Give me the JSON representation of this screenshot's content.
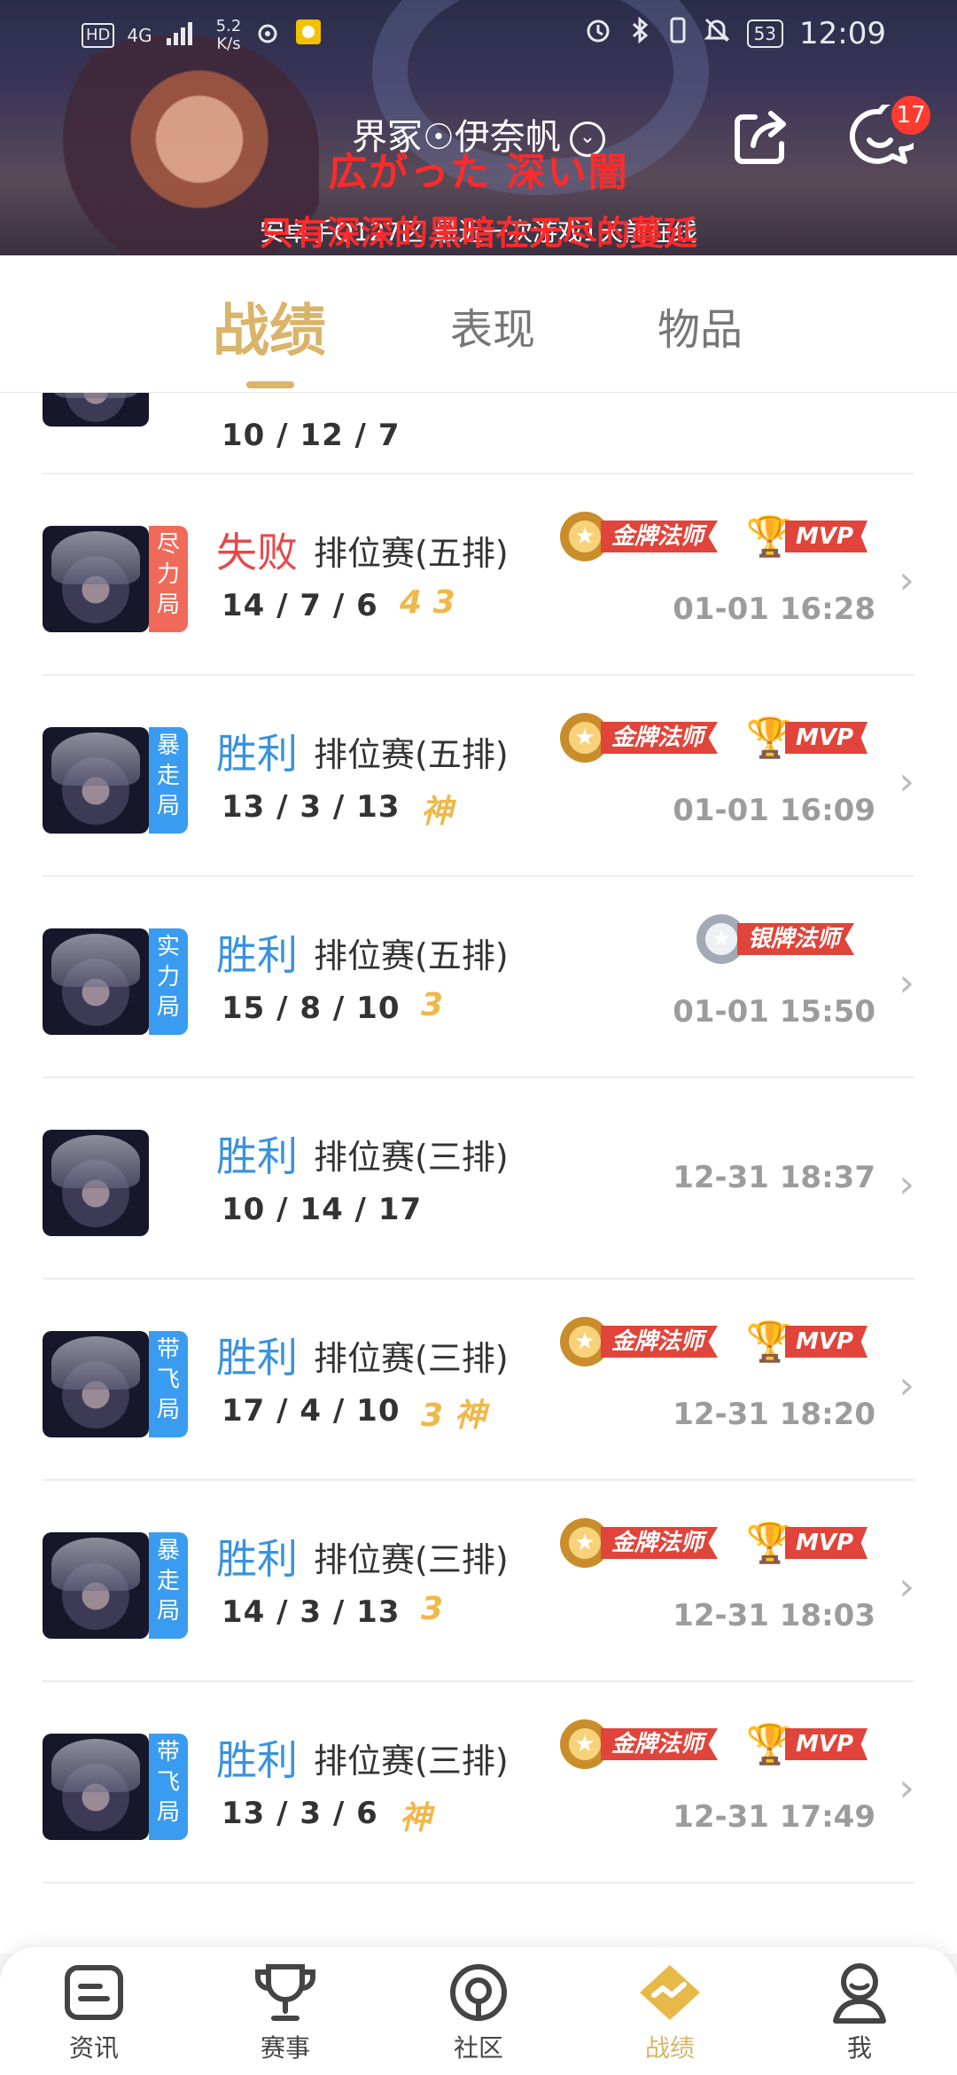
{
  "status_bar": {
    "hd": "HD",
    "network": "4G",
    "speed_value": "5.2",
    "speed_unit": "K/s",
    "battery": "53",
    "time": "12:09"
  },
  "header": {
    "profile_name": "界冢☉伊奈帆",
    "overlay_jp": "広がった 深い闇",
    "subtitle": "安卓手Q127区 最近一次游戏1天前在线",
    "overlay_cn": "只有深深的黑暗在无尽的蔓延",
    "message_badge": "17",
    "share_icon": "share-icon",
    "message_icon": "chat-icon"
  },
  "tabs": [
    {
      "label": "战绩",
      "active": true
    },
    {
      "label": "表现",
      "active": false
    },
    {
      "label": "物品",
      "active": false
    }
  ],
  "partial_row": {
    "kda": "10 / 12 / 7"
  },
  "matches": [
    {
      "tag": "尽力局",
      "tag_color": "red",
      "result": "失败",
      "win": false,
      "type": "排位赛(五排)",
      "kda": "14 / 7 / 6",
      "extras": "4  3",
      "badge": "金牌法师",
      "badge_kind": "gold",
      "mvp": "MVP",
      "time": "01-01 16:28"
    },
    {
      "tag": "暴走局",
      "tag_color": "blue",
      "result": "胜利",
      "win": true,
      "type": "排位赛(五排)",
      "kda": "13 / 3 / 13",
      "extras": "神",
      "badge": "金牌法师",
      "badge_kind": "gold",
      "mvp": "MVP",
      "time": "01-01 16:09"
    },
    {
      "tag": "实力局",
      "tag_color": "blue",
      "result": "胜利",
      "win": true,
      "type": "排位赛(五排)",
      "kda": "15 / 8 / 10",
      "extras": "3",
      "badge": "银牌法师",
      "badge_kind": "silver",
      "mvp": "",
      "time": "01-01 15:50"
    },
    {
      "tag": "",
      "tag_color": "",
      "result": "胜利",
      "win": true,
      "type": "排位赛(三排)",
      "kda": "10 / 14 / 17",
      "extras": "",
      "badge": "",
      "badge_kind": "",
      "mvp": "",
      "time": "12-31 18:37"
    },
    {
      "tag": "带飞局",
      "tag_color": "blue",
      "result": "胜利",
      "win": true,
      "type": "排位赛(三排)",
      "kda": "17 / 4 / 10",
      "extras": "3  神",
      "badge": "金牌法师",
      "badge_kind": "gold",
      "mvp": "MVP",
      "time": "12-31 18:20"
    },
    {
      "tag": "暴走局",
      "tag_color": "blue",
      "result": "胜利",
      "win": true,
      "type": "排位赛(三排)",
      "kda": "14 / 3 / 13",
      "extras": "3",
      "badge": "金牌法师",
      "badge_kind": "gold",
      "mvp": "MVP",
      "time": "12-31 18:03"
    },
    {
      "tag": "带飞局",
      "tag_color": "blue",
      "result": "胜利",
      "win": true,
      "type": "排位赛(三排)",
      "kda": "13 / 3 / 6",
      "extras": "神",
      "badge": "金牌法师",
      "badge_kind": "gold",
      "mvp": "MVP",
      "time": "12-31 17:49"
    }
  ],
  "bottom_nav": [
    {
      "label": "资讯",
      "icon": "news-icon",
      "active": false
    },
    {
      "label": "赛事",
      "icon": "trophy-icon",
      "active": false
    },
    {
      "label": "社区",
      "icon": "community-icon",
      "active": false
    },
    {
      "label": "战绩",
      "icon": "record-icon",
      "active": true
    },
    {
      "label": "我",
      "icon": "profile-icon",
      "active": false
    }
  ],
  "colors": {
    "accent_gold": "#d9b46a",
    "win_blue": "#3a92e0",
    "lose_red": "#e54a4a",
    "badge_red": "#e0443a",
    "message_badge": "#ff3b30"
  }
}
